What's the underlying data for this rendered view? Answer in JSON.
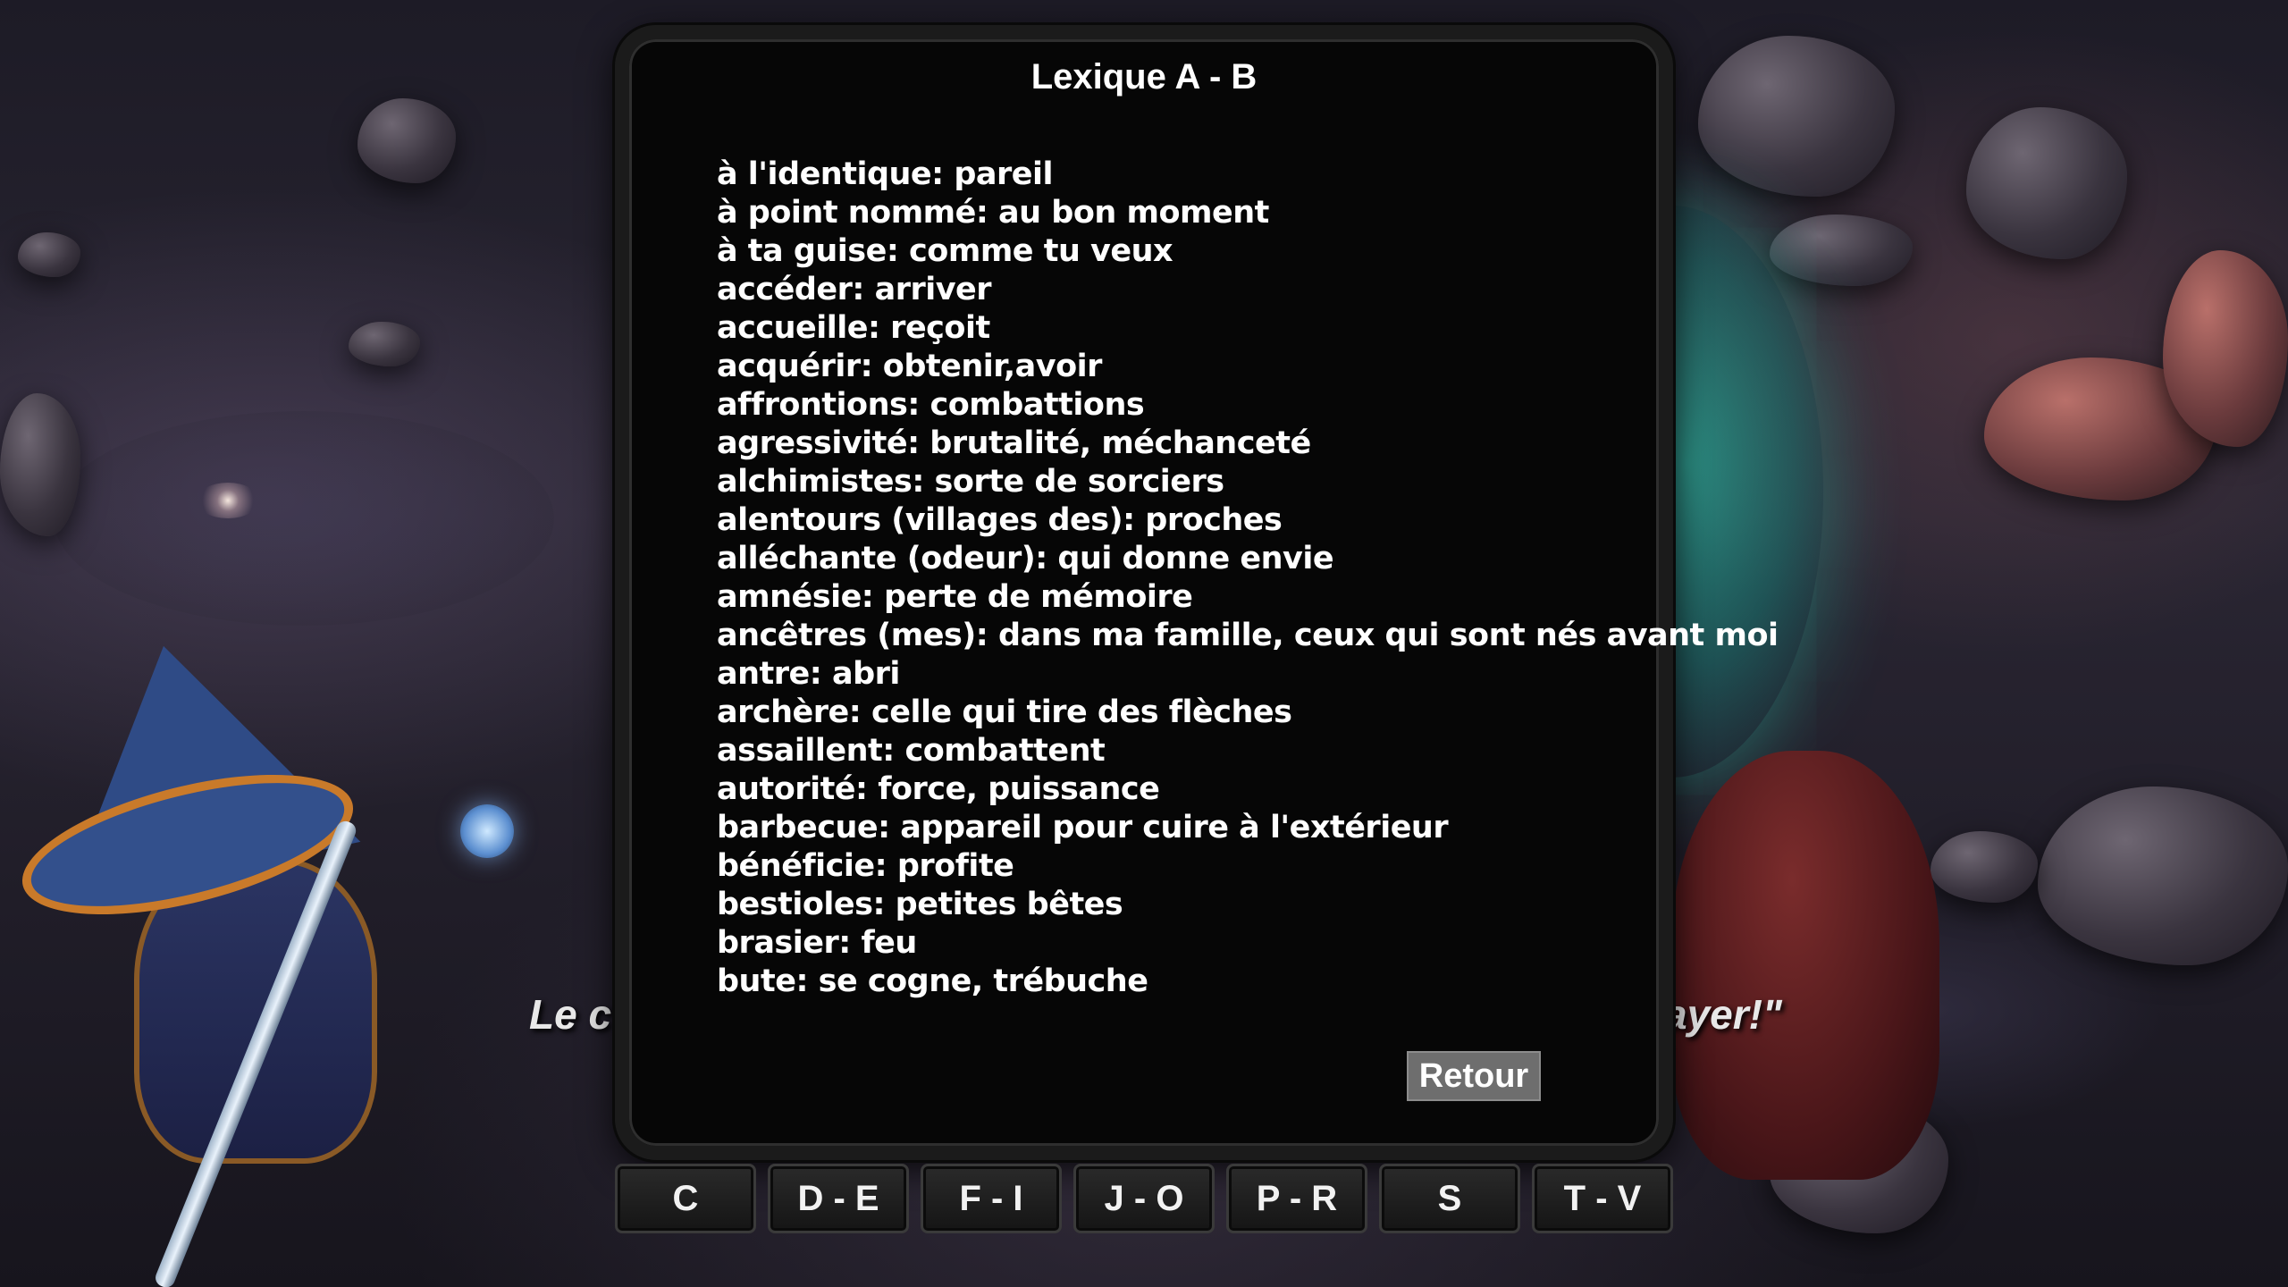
{
  "panel": {
    "title": "Lexique A - B",
    "entries": [
      "à l'identique: pareil",
      "à point nommé: au bon moment",
      "à ta guise: comme tu veux",
      "accéder: arriver",
      "accueille: reçoit",
      "acquérir: obtenir,avoir",
      "affrontions: combattions",
      "agressivité: brutalité, méchanceté",
      "alchimistes: sorte de sorciers",
      "alentours (villages des): proches",
      "alléchante (odeur): qui donne envie",
      "amnésie: perte de mémoire",
      "ancêtres (mes): dans ma famille, ceux qui sont nés avant moi",
      "antre: abri",
      "archère: celle qui tire des flèches",
      "assaillent: combattent",
      "autorité: force, puissance",
      "barbecue: appareil pour cuire à l'extérieur",
      "bénéficie: profite",
      "bestioles: petites bêtes",
      "brasier: feu",
      "bute: se cogne, trébuche"
    ],
    "back_label": "Retour"
  },
  "tabs": [
    "C",
    "D - E",
    "F - I",
    "J - O",
    "P - R",
    "S",
    "T - V"
  ],
  "subtitle": {
    "left_fragment": "Le c",
    "right_fragment": "ayer!\""
  }
}
